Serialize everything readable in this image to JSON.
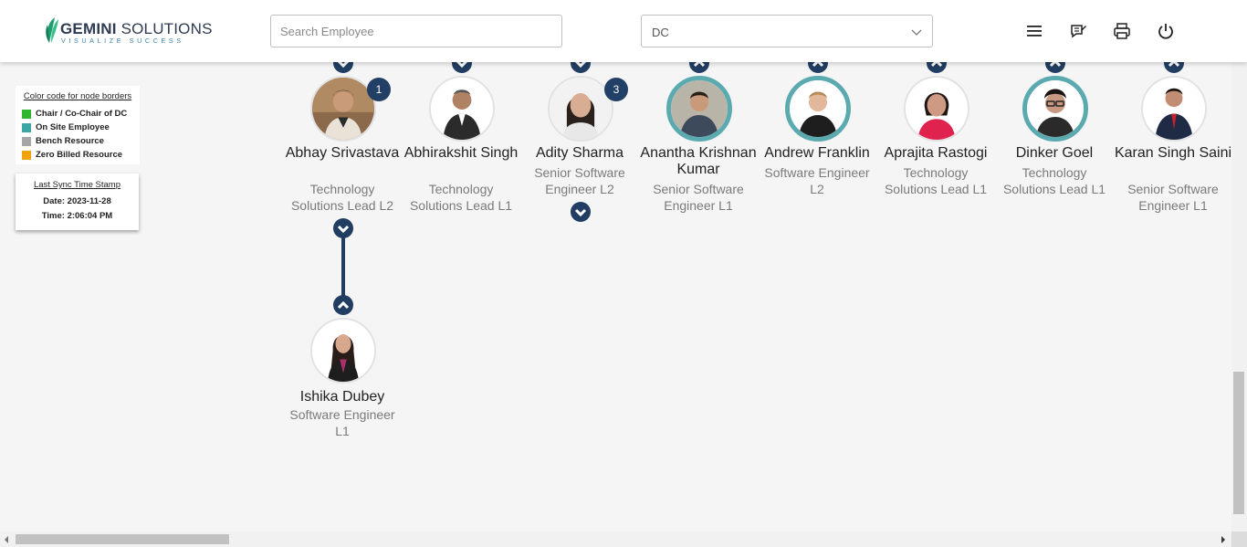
{
  "header": {
    "logo_name_bold": "GEMINI",
    "logo_name_rest": " SOLUTIONS",
    "logo_tagline": "VISUALIZE SUCCESS",
    "search_placeholder": "Search Employee",
    "department_selected": "DC",
    "icons": [
      "menu-icon",
      "feedback-icon",
      "print-icon",
      "power-icon"
    ]
  },
  "legend": {
    "title": "Color code for node borders",
    "items": [
      {
        "label": "Chair / Co-Chair of DC",
        "color": "#2fb52f"
      },
      {
        "label": "On Site Employee",
        "color": "#3aa7a7"
      },
      {
        "label": "Bench Resource",
        "color": "#a6a6a6"
      },
      {
        "label": "Zero Billed Resource",
        "color": "#f2a20c"
      }
    ]
  },
  "sync": {
    "title": "Last Sync Time Stamp",
    "date": "Date: 2023-11-28",
    "time": "Time: 2:06:04 PM"
  },
  "employees": [
    {
      "name": "Abhay Srivastava",
      "role": "Technology Solutions Lead L2",
      "badge": "1"
    },
    {
      "name": "Abhirakshit Singh",
      "role": "Technology Solutions Lead L1"
    },
    {
      "name": "Adity Sharma",
      "role": "Senior Software Engineer L2",
      "badge": "3"
    },
    {
      "name": "Anantha Krishnan Kumar",
      "role": "Senior Software Engineer L1"
    },
    {
      "name": "Andrew Franklin",
      "role": "Software Engineer L2"
    },
    {
      "name": "Aprajita Rastogi",
      "role": "Technology Solutions Lead L1"
    },
    {
      "name": "Dinker Goel",
      "role": "Technology Solutions Lead L1"
    },
    {
      "name": "Karan Singh Saini",
      "role": "Senior Software Engineer L1"
    },
    {
      "name": "Ishika Dubey",
      "role": "Software Engineer L1"
    }
  ],
  "colors": {
    "accent": "#213d61",
    "onsite_border": "#5aaab0"
  }
}
